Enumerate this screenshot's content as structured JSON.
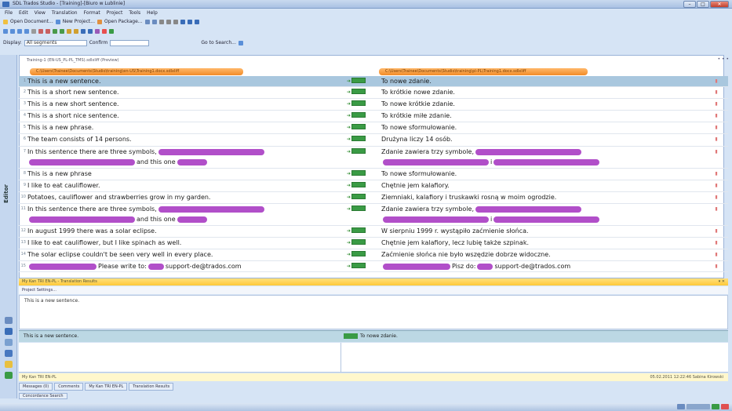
{
  "window": {
    "title": "SDL Trados Studio - [Training]-[Biuro w Lublinie]"
  },
  "menu": [
    "File",
    "Edit",
    "View",
    "Translation",
    "Format",
    "Project",
    "Tools",
    "Help"
  ],
  "toolbar": {
    "new_doc": "Open Document...",
    "new_project": "New Project...",
    "open_package": "Open Package...",
    "filter_label": "Display:",
    "filter_value": "All segments",
    "confirm_label": "Confirm",
    "search_label": "Go to Search..."
  },
  "doc_tab": "Training-1 (EN-US_PL-PL_TMS).sdlxliff (Preview)",
  "source_file": "C:\\Users\\Trainee\\Documents\\Studio\\training\\en-US\\Training1.docx.sdlxliff",
  "target_file": "C:\\Users\\Trainee\\Documents\\Studio\\training\\pl-PL\\Training1.docx.sdlxliff",
  "side_tab": "Editor",
  "segments": [
    {
      "n": "1",
      "src": "This is a new sentence.",
      "tgt": "To nowe zdanie."
    },
    {
      "n": "2",
      "src": "This is a short new sentence.",
      "tgt": "To krótkie nowe zdanie."
    },
    {
      "n": "3",
      "src": "This is a new short sentence.",
      "tgt": "To nowe krótkie zdanie."
    },
    {
      "n": "4",
      "src": "This is a short nice sentence.",
      "tgt": "To krótkie miłe zdanie."
    },
    {
      "n": "5",
      "src": "This is a new phrase.",
      "tgt": "To nowe sformułowanie."
    },
    {
      "n": "6",
      "src": "The team consists of 14 persons.",
      "tgt": "Drużyna liczy 14 osób."
    },
    {
      "n": "7",
      "src": "In this sentence there are three symbols,",
      "src2": "and this one",
      "tgt": "Zdanie zawiera trzy symbole,",
      "tgt2": "i"
    },
    {
      "n": "8",
      "src": "This is a new phrase",
      "tgt": "To nowe sformułowanie."
    },
    {
      "n": "9",
      "src": "I like to eat cauliflower.",
      "tgt": "Chętnie jem kalafiory."
    },
    {
      "n": "10",
      "src": "Potatoes, cauliflower and strawberries grow in my garden.",
      "tgt": "Ziemniaki, kalafiory i truskawki rosną w moim ogrodzie."
    },
    {
      "n": "11",
      "src": "In this sentence there are three symbols,",
      "src2": "and this one",
      "tgt": "Zdanie zawiera trzy symbole,",
      "tgt2": "i"
    },
    {
      "n": "12",
      "src": "In august 1999 there was a solar eclipse.",
      "tgt": "W sierpniu 1999 r. wystąpiło zaćmienie słońca."
    },
    {
      "n": "13",
      "src": "I like to eat cauliflower, but I like spinach as well.",
      "tgt": "Chętnie jem kalafiory, lecz lubię także szpinak."
    },
    {
      "n": "14",
      "src": "The solar eclipse couldn't be seen very well in every place.",
      "tgt": "Zaćmienie słońca nie było wszędzie dobrze widoczne."
    },
    {
      "n": "15",
      "src": "Please write to:",
      "src2": "support-de@trados.com",
      "tgt": "Pisz do:",
      "tgt2": "support-de@trados.com"
    }
  ],
  "tm": {
    "header": "My Kan TRI EN-PL - Translation Results",
    "toolbar": "Project Settings...",
    "query": "This is a new sentence.",
    "result_src": "This is a new sentence.",
    "result_tgt": "To nowe zdanie.",
    "status_left": "My Kan TRI EN-PL",
    "status_right": "05.02.2011 12:22:46  Sabina Kirowski"
  },
  "bottom_tabs": [
    "Messages (0)",
    "Comments",
    "My Kan TRI EN-PL",
    "Translation Results"
  ],
  "bottom_tab2": "Concordance Search",
  "colors": {
    "accent": "#f28c28",
    "tag": "#b14fc9",
    "confirmed": "#3a9b45",
    "selected": "#a9c7de"
  }
}
